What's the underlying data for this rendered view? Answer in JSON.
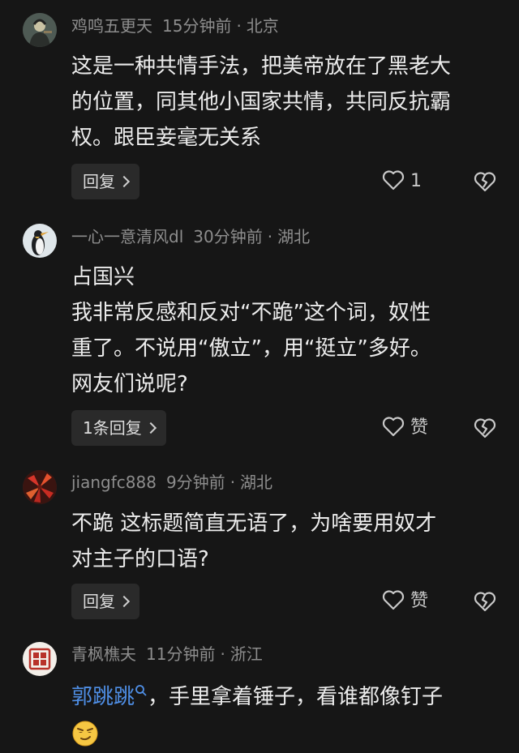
{
  "comments": [
    {
      "username": "鸡鸣五更天",
      "time": "15分钟前",
      "location": "北京",
      "lines": [
        "这是一种共情手法，把美帝放在了黑老大",
        "的位置，同其他小国家共情，共同反抗霸",
        "权。跟臣妾毫无关系"
      ],
      "reply_label": "回复",
      "like_count": "1"
    },
    {
      "username": "一心一意清风dl",
      "time": "30分钟前",
      "location": "湖北",
      "lines": [
        "占国兴",
        "我非常反感和反对“不跪”这个词，奴性",
        "重了。不说用“傲立”，用“挺立”多好。",
        "网友们说呢?"
      ],
      "reply_label": "1条回复",
      "like_count": "赞"
    },
    {
      "username": "jiangfc888",
      "time": "9分钟前",
      "location": "湖北",
      "lines": [
        "不跪 这标题简直无语了，为啥要用奴才",
        "对主子的口语?"
      ],
      "reply_label": "回复",
      "like_count": "赞"
    },
    {
      "username": "青枫樵夫",
      "time": "11分钟前",
      "location": "浙江",
      "mention": "郭跳跳",
      "text_after_mention": "，手里拿着锤子，看谁都像钉子",
      "emoji": "smirk-face-emoji"
    }
  ],
  "colors": {
    "background": "#161616",
    "meta_text": "#8d8d8d",
    "body_text": "#ececec",
    "mention": "#4f8fe6",
    "button_bg": "#2a2a2a"
  }
}
